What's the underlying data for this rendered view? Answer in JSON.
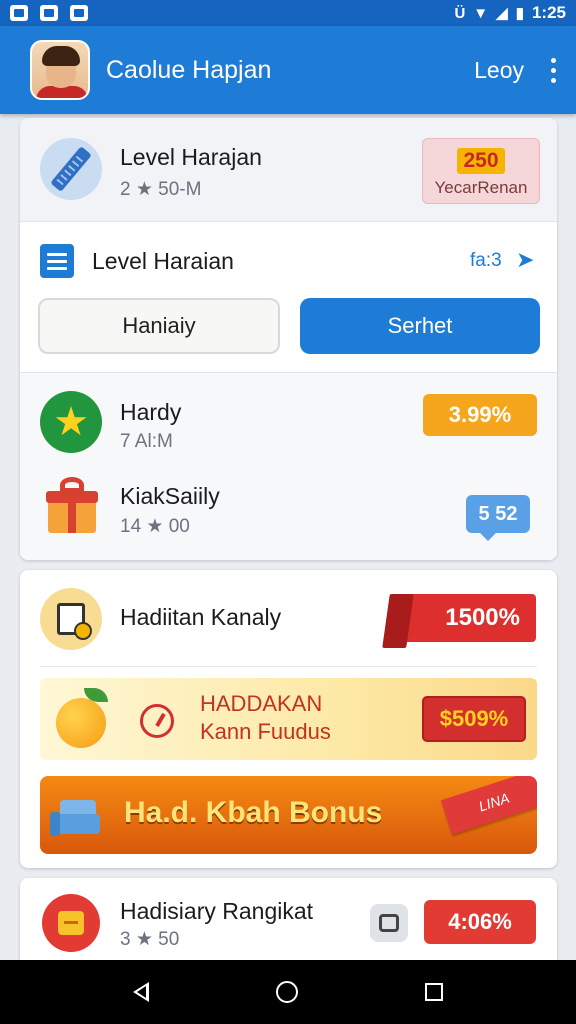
{
  "status_bar": {
    "time": "1:25",
    "icons": [
      "image-icon",
      "photo-icon",
      "mail-icon",
      "vibrate-icon",
      "wifi-icon",
      "signal-icon",
      "battery-icon"
    ]
  },
  "app_bar": {
    "title": "Caolue Hapjan",
    "action_label": "Leoy",
    "menu_icon": "more-vert-icon"
  },
  "header_item": {
    "title": "Level Harajan",
    "subtitle": "2 ★ 50-M",
    "badge_value": "250",
    "badge_caption": "YecarRenan",
    "icon": "ruler-icon"
  },
  "section": {
    "title": "Level Haraian",
    "link_label": "fa:3",
    "link_icon": "arrow-right-icon"
  },
  "buttons": {
    "secondary": "Haniaiy",
    "primary": "Serhet"
  },
  "list_items": [
    {
      "title": "Hardy",
      "subtitle": "7 Al:M",
      "badge": "3.99%",
      "icon": "star-icon"
    },
    {
      "title": "KiakSaiily",
      "subtitle": "14 ★ 00",
      "badge": "5 52",
      "icon": "gift-icon"
    }
  ],
  "offer": {
    "title": "Hadiitan Kanaly",
    "badge": "1500%",
    "icon": "document-icon"
  },
  "promo": {
    "line1": "HADDAKAN",
    "line2": "Kann Fuudus",
    "price": "$509%",
    "icon": "orange-icon"
  },
  "bonus": {
    "label": "Ha.d. Kbah Bonus",
    "ribbon": "LINA"
  },
  "bottom_item": {
    "title": "Hadisiary Rangikat",
    "subtitle": "3 ★ 50",
    "badge": "4:06%",
    "icon": "wallet-icon"
  },
  "colors": {
    "primary": "#1e7bd6",
    "accent_orange": "#f5a61c",
    "accent_red": "#de2f2f",
    "green": "#22963f"
  }
}
